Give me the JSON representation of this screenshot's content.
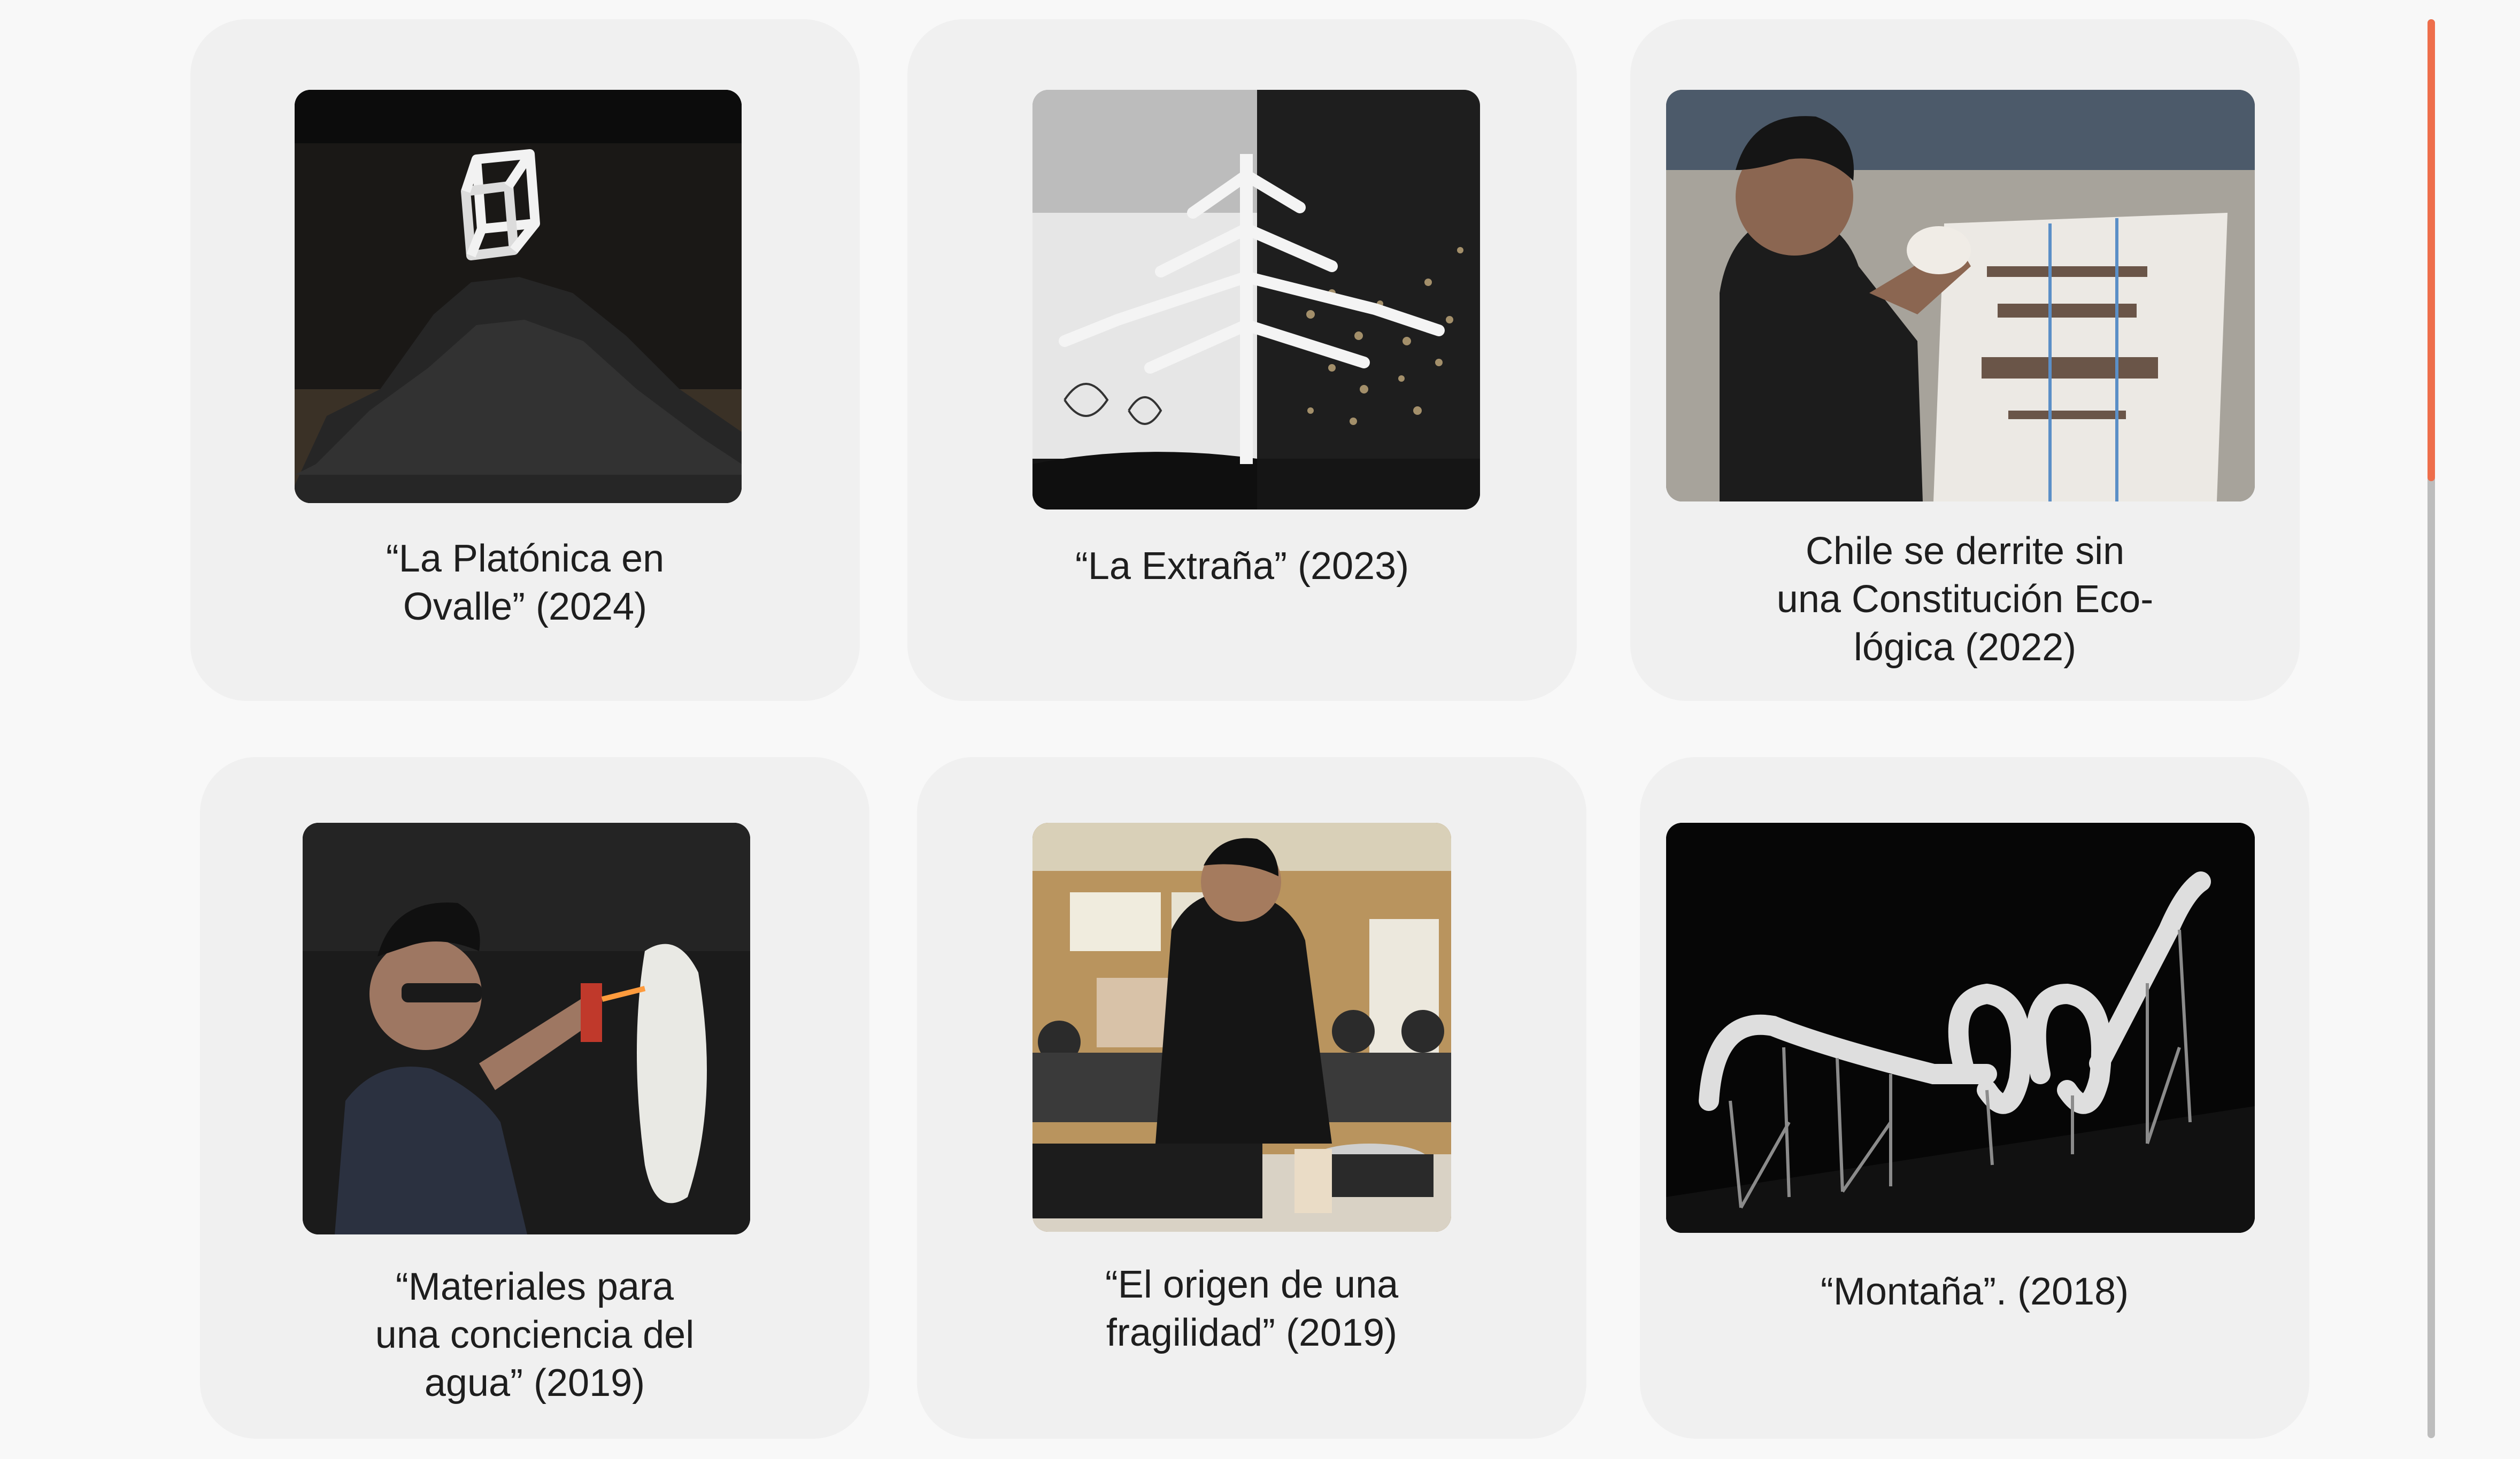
{
  "gallery": {
    "items": [
      {
        "caption": "“La Platónica en\nOvalle” (2024)",
        "image": "pile-of-coal-with-white-cube-sculpture"
      },
      {
        "caption": "“La Extraña” (2023)",
        "image": "white-tree-sculpture-installation"
      },
      {
        "caption": "Chile se derrite sin\nuna Constitución Eco-\nlógica (2022)",
        "image": "artist-carving-ice-block"
      },
      {
        "caption": "“Materiales para\nuna conciencia del\nagua” (2019)",
        "image": "artist-with-torch-and-ice-sheet"
      },
      {
        "caption": "“El origen de una\nfragilidad” (2019)",
        "image": "artist-at-dj-mixer-performance"
      },
      {
        "caption": "“Montaña”. (2018)",
        "image": "white-rollercoaster-sculpture"
      }
    ]
  },
  "scrollbar": {
    "track_color": "#bdbdbd",
    "thumb_color": "#ee6e4b"
  }
}
